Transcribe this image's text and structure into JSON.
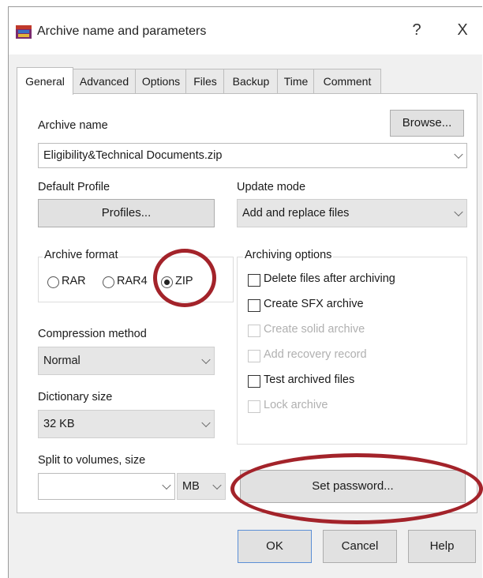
{
  "window": {
    "title": "Archive name and parameters",
    "help_label": "?",
    "close_label": "X"
  },
  "tabs": [
    {
      "label": "General",
      "active": true
    },
    {
      "label": "Advanced"
    },
    {
      "label": "Options"
    },
    {
      "label": "Files"
    },
    {
      "label": "Backup"
    },
    {
      "label": "Time"
    },
    {
      "label": "Comment"
    }
  ],
  "archive_name": {
    "label": "Archive name",
    "value": "Eligibility&Technical Documents.zip",
    "browse_label": "Browse..."
  },
  "default_profile": {
    "label": "Default Profile",
    "button_label": "Profiles..."
  },
  "update_mode": {
    "label": "Update mode",
    "value": "Add and replace files"
  },
  "archive_format": {
    "label": "Archive format",
    "options": [
      "RAR",
      "RAR4",
      "ZIP"
    ],
    "selected": "ZIP"
  },
  "compression_method": {
    "label": "Compression method",
    "value": "Normal"
  },
  "dictionary_size": {
    "label": "Dictionary size",
    "value": "32 KB"
  },
  "split_volumes": {
    "label": "Split to volumes, size",
    "value": "",
    "unit": "MB"
  },
  "archiving_options": {
    "label": "Archiving options",
    "items": [
      {
        "label": "Delete files after archiving",
        "enabled": true,
        "checked": false
      },
      {
        "label": "Create SFX archive",
        "enabled": true,
        "checked": false
      },
      {
        "label": "Create solid archive",
        "enabled": false,
        "checked": false
      },
      {
        "label": "Add recovery record",
        "enabled": false,
        "checked": false
      },
      {
        "label": "Test archived files",
        "enabled": true,
        "checked": false
      },
      {
        "label": "Lock archive",
        "enabled": false,
        "checked": false
      }
    ]
  },
  "set_password_label": "Set password...",
  "buttons": {
    "ok": "OK",
    "cancel": "Cancel",
    "help": "Help"
  },
  "colors": {
    "highlight_circle": "#a3232a"
  }
}
